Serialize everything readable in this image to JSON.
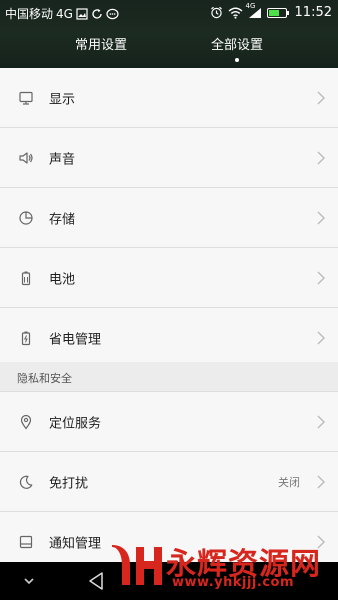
{
  "status_bar": {
    "carrier": "中国移动",
    "network": "4G",
    "lte": "4G",
    "time": "11:52",
    "battery_level": 0.6
  },
  "tabs": {
    "common": "常用设置",
    "all": "全部设置",
    "selected": "all"
  },
  "rows": {
    "display": "显示",
    "sound": "声音",
    "storage": "存储",
    "battery": "电池",
    "power_saving": "省电管理",
    "location": "定位服务",
    "dnd": "免打扰",
    "dnd_value": "关闭",
    "notification": "通知管理"
  },
  "sections": {
    "privacy": "隐私和安全"
  },
  "watermark": {
    "title": "永辉资源网",
    "url": "www.yhkjjj.com"
  },
  "colors": {
    "header_bg": "#18241d",
    "list_bg": "#f7f7f7",
    "watermark": "#d7261d",
    "battery_fill": "#4ee04a"
  }
}
